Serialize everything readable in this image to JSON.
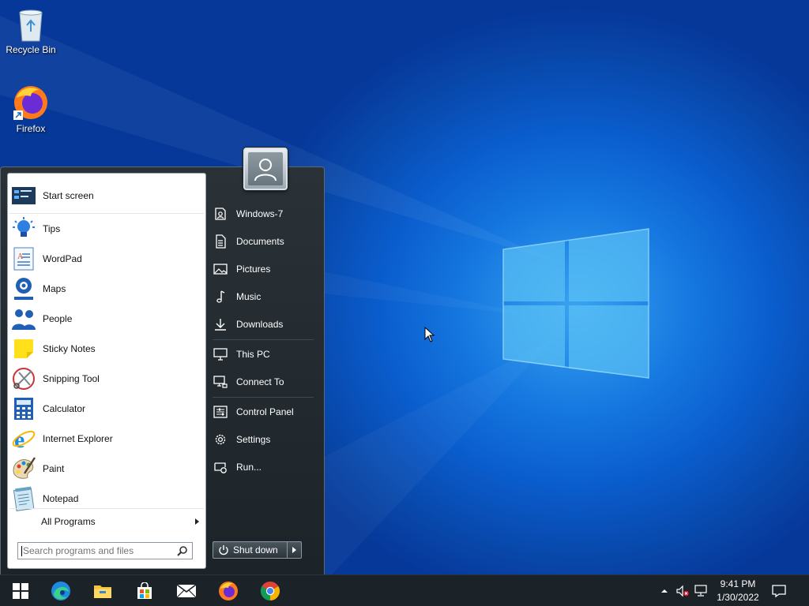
{
  "desktop": {
    "icons": [
      {
        "label": "Recycle Bin",
        "icon": "recycle-bin-icon"
      },
      {
        "label": "Firefox",
        "icon": "firefox-icon"
      }
    ]
  },
  "start_menu": {
    "programs": [
      {
        "label": "Start screen",
        "icon": "start-screen-icon"
      },
      {
        "label": "Tips",
        "icon": "lightbulb-icon"
      },
      {
        "label": "WordPad",
        "icon": "wordpad-icon"
      },
      {
        "label": "Maps",
        "icon": "maps-icon"
      },
      {
        "label": "People",
        "icon": "people-icon"
      },
      {
        "label": "Sticky Notes",
        "icon": "sticky-notes-icon"
      },
      {
        "label": "Snipping Tool",
        "icon": "snipping-tool-icon"
      },
      {
        "label": "Calculator",
        "icon": "calculator-icon"
      },
      {
        "label": "Internet Explorer",
        "icon": "internet-explorer-icon"
      },
      {
        "label": "Paint",
        "icon": "paint-icon"
      },
      {
        "label": "Notepad",
        "icon": "notepad-icon"
      }
    ],
    "all_programs": "All Programs",
    "search_placeholder": "Search programs and files",
    "right_items": [
      {
        "label": "Windows-7",
        "icon": "user-folder-icon"
      },
      {
        "label": "Documents",
        "icon": "documents-icon"
      },
      {
        "label": "Pictures",
        "icon": "pictures-icon"
      },
      {
        "label": "Music",
        "icon": "music-icon"
      },
      {
        "label": "Downloads",
        "icon": "downloads-icon"
      },
      {
        "label": "This PC",
        "icon": "computer-icon"
      },
      {
        "label": "Connect To",
        "icon": "connect-icon"
      },
      {
        "label": "Control Panel",
        "icon": "control-panel-icon"
      },
      {
        "label": "Settings",
        "icon": "gear-icon"
      },
      {
        "label": "Run...",
        "icon": "run-icon"
      }
    ],
    "shutdown_label": "Shut down"
  },
  "taskbar": {
    "apps": [
      {
        "icon": "windows-start-icon"
      },
      {
        "icon": "edge-icon"
      },
      {
        "icon": "file-explorer-icon"
      },
      {
        "icon": "store-icon"
      },
      {
        "icon": "mail-icon"
      },
      {
        "icon": "firefox-icon"
      },
      {
        "icon": "chrome-icon"
      }
    ],
    "time": "9:41 PM",
    "date": "1/30/2022"
  },
  "colors": {
    "taskbar": "#1b2228",
    "menu_dark": "#1c2429",
    "desktop_blue": "#0a5ccc"
  }
}
